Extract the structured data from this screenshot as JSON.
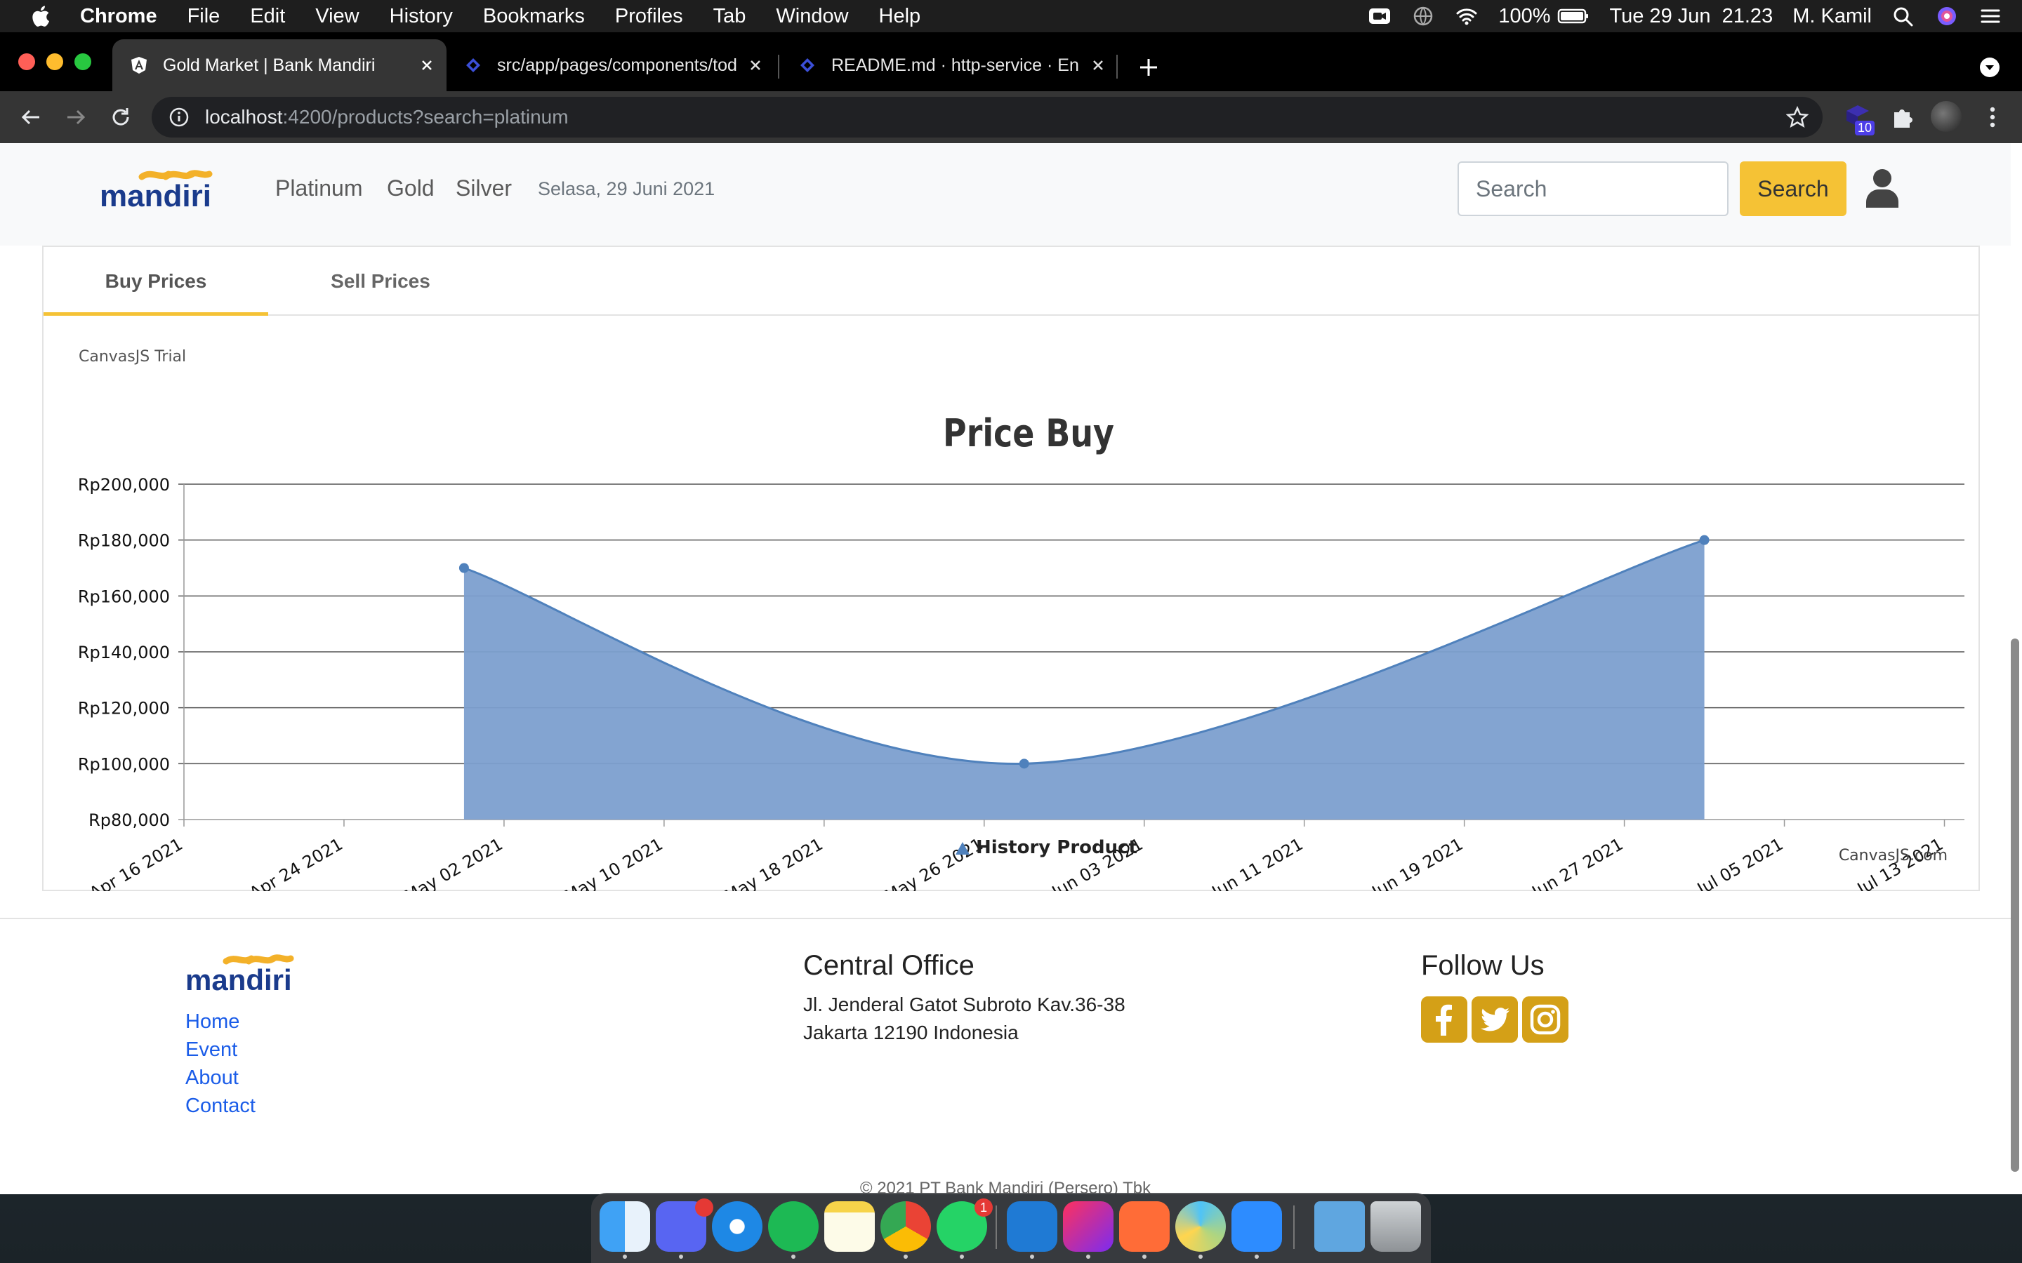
{
  "menubar": {
    "app_name": "Chrome",
    "items": [
      "File",
      "Edit",
      "View",
      "History",
      "Bookmarks",
      "Profiles",
      "Tab",
      "Window",
      "Help"
    ],
    "battery": "100%",
    "datetime": "Tue 29 Jun  21.23",
    "user": "M. Kamil"
  },
  "browser": {
    "tabs": [
      {
        "title": "Gold Market | Bank Mandiri",
        "active": true
      },
      {
        "title": "src/app/pages/components/tod",
        "active": false
      },
      {
        "title": "README.md · http-service · En",
        "active": false
      }
    ],
    "url_host": "localhost",
    "url_rest": ":4200/products?search=platinum",
    "extension_badge": "10"
  },
  "site_nav": {
    "logo_text": "mandiri",
    "links": [
      "Platinum",
      "Gold",
      "Silver"
    ],
    "date": "Selasa, 29 Juni 2021",
    "search_placeholder": "Search",
    "search_button": "Search"
  },
  "card": {
    "tabs": [
      "Buy Prices",
      "Sell Prices"
    ],
    "active_tab": "Buy Prices"
  },
  "chart_data": {
    "type": "area",
    "title": "Price Buy",
    "watermark": "CanvasJS Trial",
    "credit": "CanvasJS.com",
    "x_tick_labels": [
      "Apr 16 2021",
      "Apr 24 2021",
      "May 02 2021",
      "May 10 2021",
      "May 18 2021",
      "May 26 2021",
      "Jun 03 2021",
      "Jun 11 2021",
      "Jun 19 2021",
      "Jun 27 2021",
      "Jul 05 2021",
      "Jul 13 2021"
    ],
    "xlim": [
      "2021-04-16",
      "2021-07-14"
    ],
    "y_tick_labels": [
      "Rp80,000",
      "Rp100,000",
      "Rp120,000",
      "Rp140,000",
      "Rp160,000",
      "Rp180,000",
      "Rp200,000"
    ],
    "ylim": [
      80000,
      200000
    ],
    "grid": true,
    "legend_position": "bottom",
    "series": [
      {
        "name": "History Product",
        "color": "#4f81bc",
        "points": [
          {
            "x": "2021-04-30",
            "y": 170000
          },
          {
            "x": "2021-05-28",
            "y": 100000
          },
          {
            "x": "2021-07-01",
            "y": 180000
          }
        ]
      }
    ]
  },
  "footer": {
    "logo_text": "mandiri",
    "links": [
      "Home",
      "Event",
      "About",
      "Contact"
    ],
    "office_heading": "Central Office",
    "address_line1": "Jl. Jenderal Gatot Subroto Kav.36-38",
    "address_line2": "Jakarta 12190 Indonesia",
    "follow_heading": "Follow Us",
    "social": [
      "facebook-icon",
      "twitter-icon",
      "instagram-icon"
    ],
    "copyright": "© 2021 PT Bank Mandiri (Persero) Tbk"
  },
  "dock": {
    "apps": [
      "Finder",
      "Discord",
      "Safari",
      "Spotify",
      "Notes",
      "Chrome",
      "WhatsApp",
      "VS Code",
      "IntelliJ IDEA",
      "Postman",
      "Affinity",
      "Zoom",
      "Downloads",
      "Trash"
    ],
    "badges": {
      "Discord": "",
      "WhatsApp": "1"
    }
  },
  "colors": {
    "accent_yellow": "#f5c235",
    "link_blue": "#1a5ce8",
    "mandiri_blue": "#1a3b8c",
    "mandiri_gold": "#f3b129",
    "chart_fill": "#7c9fcf"
  }
}
